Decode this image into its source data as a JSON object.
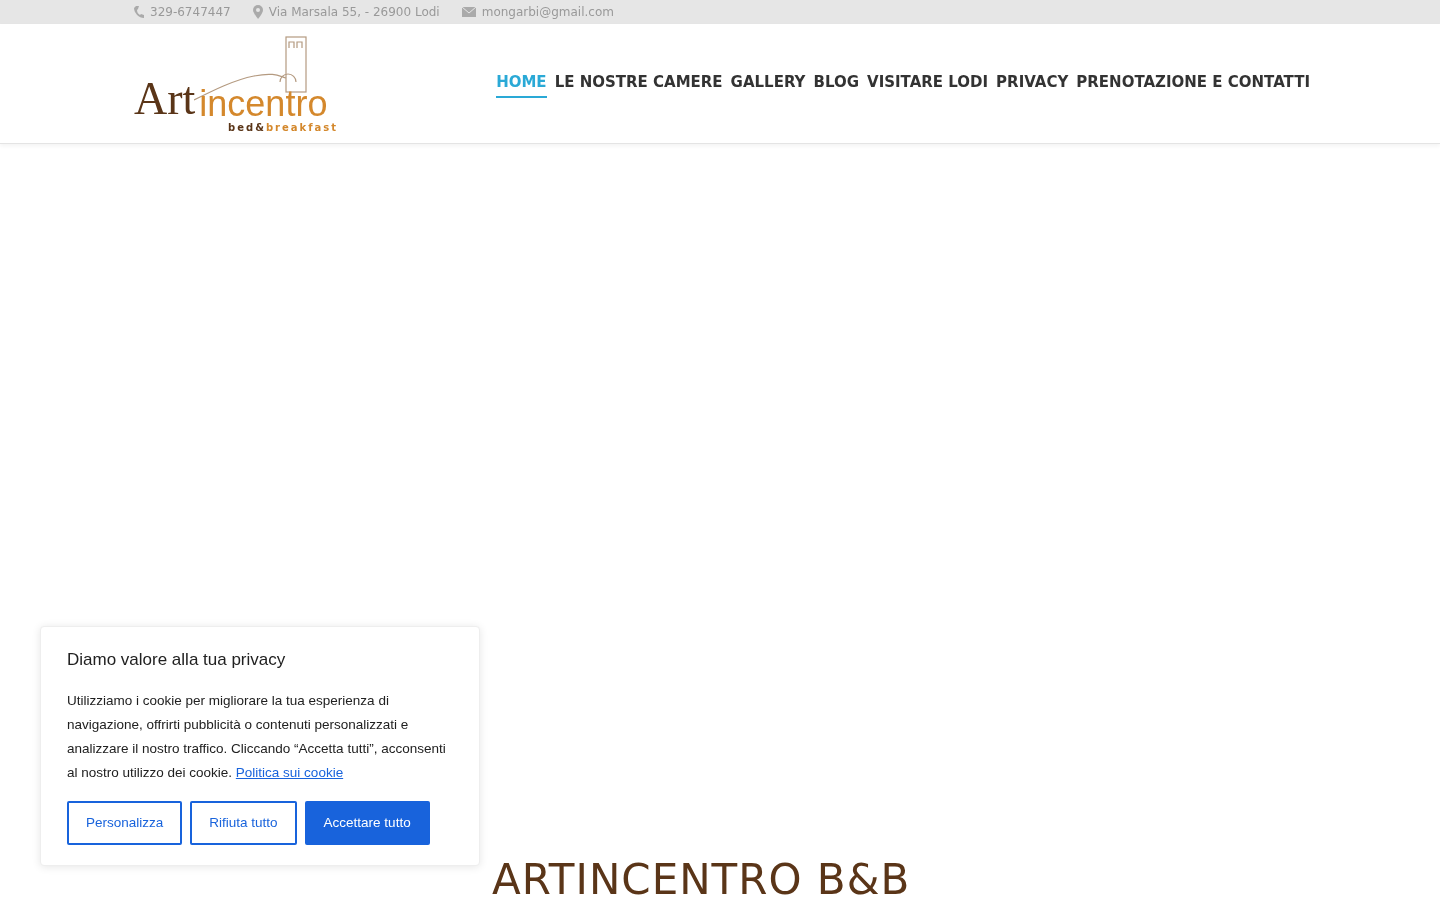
{
  "topbar": {
    "phone": "329-6747447",
    "address": "Via Marsala 55, - 26900 Lodi",
    "email": "mongarbi@gmail.com"
  },
  "logo": {
    "art": "Art",
    "incentro": "incentro",
    "tagline_a": "bed&",
    "tagline_b": "breakfast"
  },
  "nav": [
    {
      "label": "HOME",
      "selected": true
    },
    {
      "label": "LE NOSTRE CAMERE",
      "selected": false
    },
    {
      "label": "GALLERY",
      "selected": false
    },
    {
      "label": "BLOG",
      "selected": false
    },
    {
      "label": "VISITARE LODI",
      "selected": false
    },
    {
      "label": "PRIVACY",
      "selected": false
    },
    {
      "label": "PRENOTAZIONE E CONTATTI",
      "selected": false
    }
  ],
  "heading": "ARTINCENTRO B&B",
  "cookie": {
    "title": "Diamo valore alla tua privacy",
    "text": "Utilizziamo i cookie per migliorare la tua esperienza di navigazione, offrirti pubblicità o contenuti personalizzati e analizzare il nostro traffico. Cliccando “Accetta tutti”, acconsenti al nostro utilizzo dei cookie.",
    "link": "Politica sui cookie",
    "buttons": [
      {
        "label": "Personalizza",
        "kind": "outline"
      },
      {
        "label": "Rifiuta tutto",
        "kind": "outline"
      },
      {
        "label": "Accettare tutto",
        "kind": "primary"
      }
    ]
  }
}
